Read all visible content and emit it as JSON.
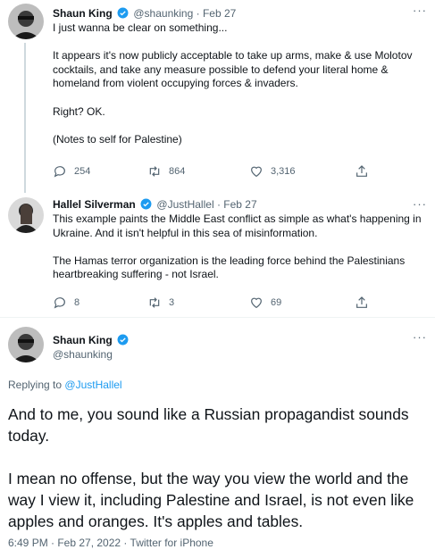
{
  "tweets": [
    {
      "name": "Shaun King",
      "handle": "@shaunking",
      "sep": "·",
      "date": "Feb 27",
      "paragraphs": [
        "I just wanna be clear on something...",
        "It appears it's now publicly acceptable to take up arms, make & use Molotov cocktails, and take any measure possible to defend your literal home & homeland from violent occupying forces & invaders.",
        "Right? OK.",
        "(Notes to self for Palestine)"
      ],
      "replies": "254",
      "retweets": "864",
      "likes": "3,316"
    },
    {
      "name": "Hallel Silverman",
      "handle": "@JustHallel",
      "sep": "·",
      "date": "Feb 27",
      "paragraphs": [
        "This example paints the Middle East conflict as simple as what's happening in Ukraine. And it isn't helpful in this sea of misinformation.",
        "The Hamas terror organization is the leading force behind the Palestinians heartbreaking suffering - not Israel."
      ],
      "replies": "8",
      "retweets": "3",
      "likes": "69"
    }
  ],
  "main": {
    "name": "Shaun King",
    "handle": "@shaunking",
    "replying_prefix": "Replying to",
    "replying_to": "@JustHallel",
    "paragraphs": [
      "And to me, you sound like a Russian propagandist sounds today.",
      "I mean no offense, but the way you view the world and the way I view it, including Palestine and Israel, is not even like apples and oranges. It's apples and tables."
    ],
    "meta": "6:49 PM · Feb 27, 2022 · Twitter for iPhone"
  },
  "more_glyph": "···",
  "colors": {
    "verified": "#1d9bf0",
    "secondary": "#536471",
    "link": "#1d9bf0"
  },
  "icons": [
    "reply-icon",
    "retweet-icon",
    "like-icon",
    "share-icon",
    "verified-icon",
    "more-icon"
  ]
}
